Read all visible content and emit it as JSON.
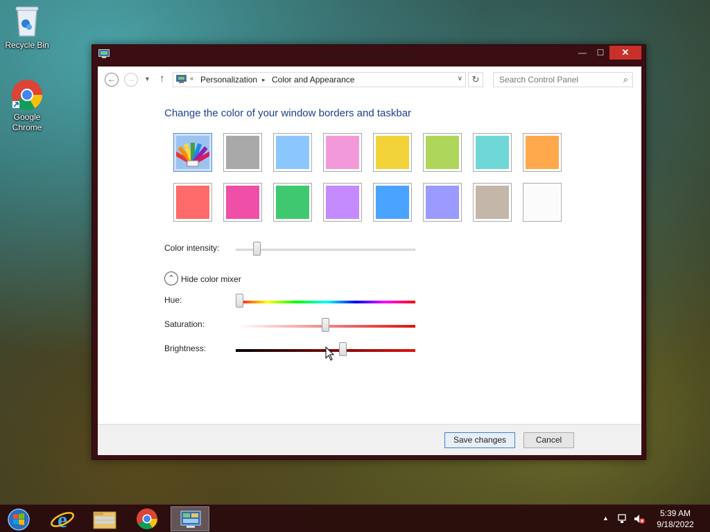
{
  "desktop": {
    "icons": [
      {
        "label": "Recycle Bin",
        "icon": "recycle-bin-icon"
      },
      {
        "label": "Google Chrome",
        "icon": "chrome-icon"
      }
    ]
  },
  "window": {
    "title": "Color and Appearance",
    "min_label": "—",
    "max_label": "☐",
    "close_label": "✕",
    "accent_color": "#3a0e12",
    "close_color": "#c7312a"
  },
  "nav": {
    "back_label": "←",
    "forward_label": "→",
    "up_label": "↑",
    "breadcrumb_sep_1": "«",
    "breadcrumb": [
      "Personalization",
      "Color and Appearance"
    ],
    "breadcrumb_sep_2": "▸",
    "dropdown_label": "∨",
    "refresh_label": "↻",
    "search_placeholder": "Search Control Panel",
    "search_icon": "⌕"
  },
  "content": {
    "heading": "Change the color of your window borders and taskbar",
    "swatches_row1": [
      "automatic",
      "#a8a8a8",
      "#8cc6ff",
      "#f29ad9",
      "#f2d43a",
      "#aed65a",
      "#6fd8d6",
      "#ffa84c"
    ],
    "swatches_row2": [
      "#ff6a6a",
      "#f04fa8",
      "#40c870",
      "#c48aff",
      "#4aa4ff",
      "#9a9aff",
      "#c4b6a8",
      "#fbfbfb"
    ],
    "selected_swatch": 0,
    "color_intensity_label": "Color intensity:",
    "color_intensity_value": 0.1,
    "mixer_toggle_label": "Hide color mixer",
    "mixer_toggle_icon": "⌃",
    "hue_label": "Hue:",
    "hue_value": 0.0,
    "saturation_label": "Saturation:",
    "saturation_value": 0.5,
    "brightness_label": "Brightness:",
    "brightness_value": 0.6
  },
  "footer": {
    "save_label": "Save changes",
    "cancel_label": "Cancel"
  },
  "taskbar": {
    "pinned": [
      "start-orb-icon",
      "internet-explorer-icon",
      "file-explorer-icon",
      "chrome-icon",
      "control-panel-icon"
    ],
    "active_index": 4,
    "tray_up_label": "▲",
    "time": "5:39 AM",
    "date": "9/18/2022"
  }
}
